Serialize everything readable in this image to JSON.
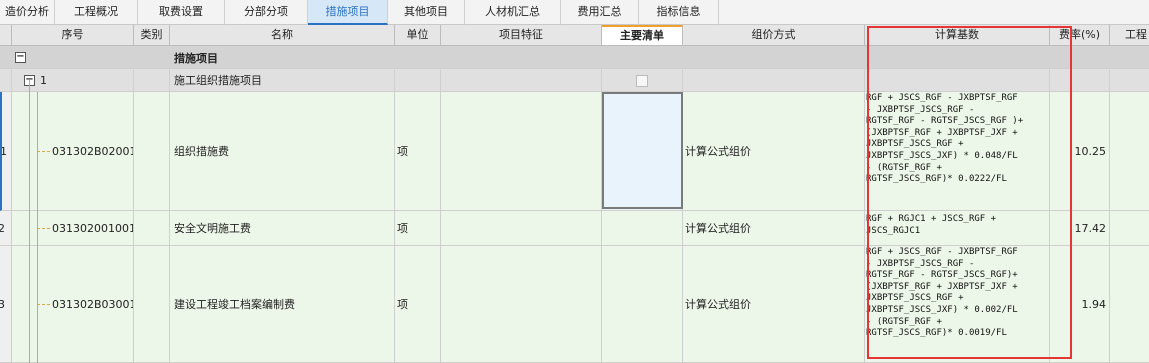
{
  "tabs": [
    {
      "label": "造价分析"
    },
    {
      "label": "工程概况"
    },
    {
      "label": "取费设置"
    },
    {
      "label": "分部分项"
    },
    {
      "label": "措施项目"
    },
    {
      "label": "其他项目"
    },
    {
      "label": "人材机汇总"
    },
    {
      "label": "费用汇总"
    },
    {
      "label": "指标信息"
    }
  ],
  "active_tab": "措施项目",
  "columns": {
    "seq": "序号",
    "category": "类别",
    "name": "名称",
    "unit": "单位",
    "feature": "项目特征",
    "main_list": "主要清单",
    "pricing": "组价方式",
    "basis": "计算基数",
    "rate": "费率(%)",
    "extra": "工程"
  },
  "rows": {
    "group": {
      "toggle": "−",
      "name": "措施项目"
    },
    "subgroup": {
      "toggle": "−",
      "seq": "1",
      "name": "施工组织措施项目"
    },
    "items": [
      {
        "index": "1",
        "code": "031302B02001",
        "name": "组织措施费",
        "unit": "项",
        "pricing": "计算公式组价",
        "basis": "RGF + JSCS_RGF - JXBPTSF_RGF\n- JXBPTSF_JSCS_RGF -\nRGTSF_RGF - RGTSF_JSCS_RGF )+\n(JXBPTSF_RGF + JXBPTSF_JXF +\nJXBPTSF_JSCS_RGF +\nJXBPTSF_JSCS_JXF) * 0.048/FL\n- (RGTSF_RGF +\nRGTSF_JSCS_RGF)* 0.0222/FL",
        "rate": "10.25"
      },
      {
        "index": "2",
        "code": "031302001001",
        "name": "安全文明施工费",
        "unit": "项",
        "pricing": "计算公式组价",
        "basis": "RGF + RGJC1 + JSCS_RGF +\nJSCS_RGJC1",
        "rate": "17.42"
      },
      {
        "index": "3",
        "code": "031302B03001",
        "name": "建设工程竣工档案编制费",
        "unit": "项",
        "pricing": "计算公式组价",
        "basis": "RGF + JSCS_RGF - JXBPTSF_RGF\n- JXBPTSF_JSCS_RGF -\nRGTSF_RGF - RGTSF_JSCS_RGF)+\n(JXBPTSF_RGF + JXBPTSF_JXF +\nJXBPTSF_JSCS_RGF +\nJXBPTSF_JSCS_JXF) * 0.002/FL\n- (RGTSF_RGF +\nRGTSF_JSCS_RGF)* 0.0019/FL",
        "rate": "1.94"
      }
    ]
  }
}
